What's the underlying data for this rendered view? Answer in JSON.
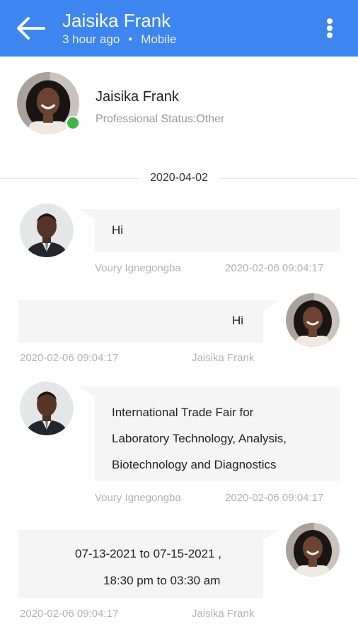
{
  "header": {
    "title": "Jaisika Frank",
    "last_seen": "3 hour ago",
    "separator": "•",
    "device": "Mobile",
    "back_icon": "arrow-left-icon",
    "menu_icon": "more-vertical-icon",
    "bar_color": "#3d86f0"
  },
  "profile": {
    "name": "Jaisika Frank",
    "status": "Professional Status:Other",
    "online": true,
    "online_color": "#3fb54a"
  },
  "date_divider": "2020-04-02",
  "messages": [
    {
      "direction": "incoming",
      "sender": "Voury Ignegongba",
      "time": "2020-02-06 09:04:17",
      "lines": [
        "Hi"
      ]
    },
    {
      "direction": "outgoing",
      "sender": "Jaisika Frank",
      "time": "2020-02-06 09:04:17",
      "lines": [
        "Hi"
      ]
    },
    {
      "direction": "incoming",
      "sender": "Voury Ignegongba",
      "time": "2020-02-06 09:04:17",
      "lines": [
        "International Trade Fair for",
        "Laboratory Technology, Analysis,",
        "Biotechnology and Diagnostics"
      ]
    },
    {
      "direction": "outgoing",
      "sender": "Jaisika Frank",
      "time": "2020-02-06 09:04:17",
      "lines": [
        "07-13-2021 to 07-15-2021 ,",
        "18:30 pm to 03:30 am"
      ]
    }
  ]
}
